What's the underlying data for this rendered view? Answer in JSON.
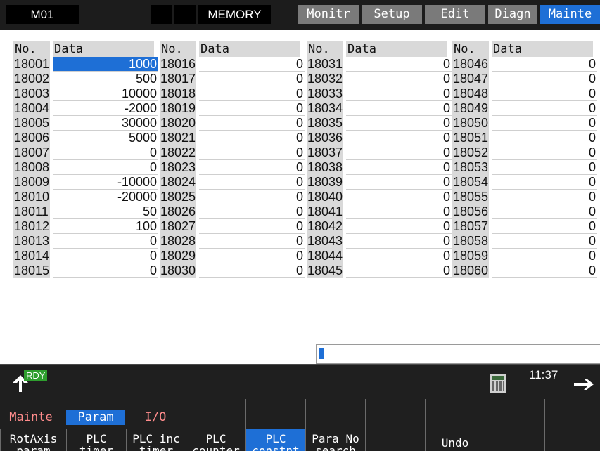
{
  "status_bar": {
    "system": "M01",
    "mode": "MEMORY",
    "menu_tabs": [
      "Monitr",
      "Setup",
      "Edit",
      "Diagn",
      "Mainte"
    ],
    "active_tab": "Mainte"
  },
  "table": {
    "header_no": "No.",
    "header_data": "Data",
    "columns": [
      {
        "rows": [
          {
            "no": "18001",
            "value": "1000"
          },
          {
            "no": "18002",
            "value": "500"
          },
          {
            "no": "18003",
            "value": "10000"
          },
          {
            "no": "18004",
            "value": "-2000"
          },
          {
            "no": "18005",
            "value": "30000"
          },
          {
            "no": "18006",
            "value": "5000"
          },
          {
            "no": "18007",
            "value": "0"
          },
          {
            "no": "18008",
            "value": "0"
          },
          {
            "no": "18009",
            "value": "-10000"
          },
          {
            "no": "18010",
            "value": "-20000"
          },
          {
            "no": "18011",
            "value": "50"
          },
          {
            "no": "18012",
            "value": "100"
          },
          {
            "no": "18013",
            "value": "0"
          },
          {
            "no": "18014",
            "value": "0"
          },
          {
            "no": "18015",
            "value": "0"
          }
        ]
      },
      {
        "rows": [
          {
            "no": "18016",
            "value": "0"
          },
          {
            "no": "18017",
            "value": "0"
          },
          {
            "no": "18018",
            "value": "0"
          },
          {
            "no": "18019",
            "value": "0"
          },
          {
            "no": "18020",
            "value": "0"
          },
          {
            "no": "18021",
            "value": "0"
          },
          {
            "no": "18022",
            "value": "0"
          },
          {
            "no": "18023",
            "value": "0"
          },
          {
            "no": "18024",
            "value": "0"
          },
          {
            "no": "18025",
            "value": "0"
          },
          {
            "no": "18026",
            "value": "0"
          },
          {
            "no": "18027",
            "value": "0"
          },
          {
            "no": "18028",
            "value": "0"
          },
          {
            "no": "18029",
            "value": "0"
          },
          {
            "no": "18030",
            "value": "0"
          }
        ]
      },
      {
        "rows": [
          {
            "no": "18031",
            "value": "0"
          },
          {
            "no": "18032",
            "value": "0"
          },
          {
            "no": "18033",
            "value": "0"
          },
          {
            "no": "18034",
            "value": "0"
          },
          {
            "no": "18035",
            "value": "0"
          },
          {
            "no": "18036",
            "value": "0"
          },
          {
            "no": "18037",
            "value": "0"
          },
          {
            "no": "18038",
            "value": "0"
          },
          {
            "no": "18039",
            "value": "0"
          },
          {
            "no": "18040",
            "value": "0"
          },
          {
            "no": "18041",
            "value": "0"
          },
          {
            "no": "18042",
            "value": "0"
          },
          {
            "no": "18043",
            "value": "0"
          },
          {
            "no": "18044",
            "value": "0"
          },
          {
            "no": "18045",
            "value": "0"
          }
        ]
      },
      {
        "rows": [
          {
            "no": "18046",
            "value": "0"
          },
          {
            "no": "18047",
            "value": "0"
          },
          {
            "no": "18048",
            "value": "0"
          },
          {
            "no": "18049",
            "value": "0"
          },
          {
            "no": "18050",
            "value": "0"
          },
          {
            "no": "18051",
            "value": "0"
          },
          {
            "no": "18052",
            "value": "0"
          },
          {
            "no": "18053",
            "value": "0"
          },
          {
            "no": "18054",
            "value": "0"
          },
          {
            "no": "18055",
            "value": "0"
          },
          {
            "no": "18056",
            "value": "0"
          },
          {
            "no": "18057",
            "value": "0"
          },
          {
            "no": "18058",
            "value": "0"
          },
          {
            "no": "18059",
            "value": "0"
          },
          {
            "no": "18060",
            "value": "0"
          }
        ]
      }
    ],
    "selected": "18001"
  },
  "input_field": {
    "value": ""
  },
  "status": {
    "ready": "RDY",
    "clock": "11:37",
    "home_icon": "up-arrow-icon",
    "calculator_icon": "calculator-icon",
    "next_icon": "right-arrow-icon"
  },
  "menu_group_tabs": [
    {
      "label": "Mainte"
    },
    {
      "label": "Param",
      "active": true
    },
    {
      "label": "I/O"
    }
  ],
  "softkeys": [
    {
      "line1": "RotAxis",
      "line2": "param"
    },
    {
      "line1": "PLC",
      "line2": "timer"
    },
    {
      "line1": "PLC inc",
      "line2": "timer"
    },
    {
      "line1": "PLC",
      "line2": "counter"
    },
    {
      "line1": "PLC",
      "line2": "constnt",
      "active": true
    },
    {
      "line1": "Para No",
      "line2": "search"
    },
    {
      "line1": "",
      "line2": ""
    },
    {
      "line1": "Undo",
      "line2": ""
    },
    {
      "line1": "",
      "line2": ""
    },
    {
      "line1": "",
      "line2": ""
    }
  ],
  "colors": {
    "accent": "#1e6fd6",
    "ready": "#2e9e2e",
    "menu_tab": "#7a7a7a",
    "menu_group_text": "#ff8c8c"
  }
}
